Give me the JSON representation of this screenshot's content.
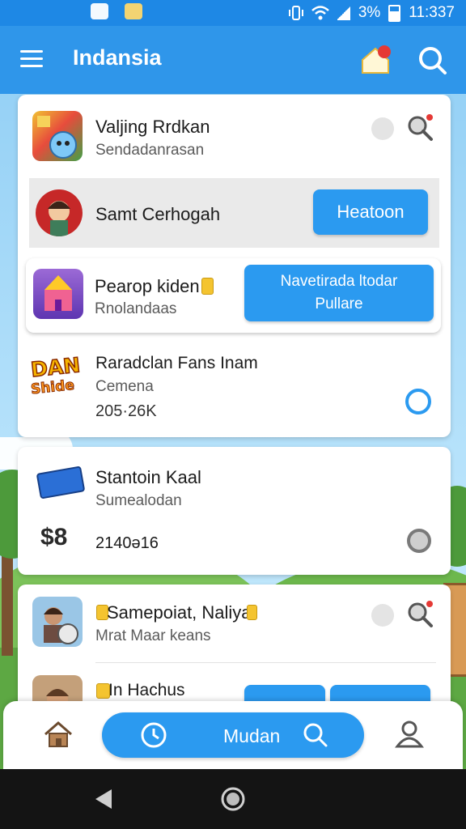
{
  "status_bar": {
    "battery": "3%",
    "time": "11:337"
  },
  "app_bar": {
    "title": "Indansia"
  },
  "cards": {
    "c1": {
      "title": "Valjing Rrdkan",
      "subtitle": "Sendadanrasan"
    },
    "c1_row2": {
      "title": "Samt Cerhogah",
      "button": "Heatoon"
    },
    "c2": {
      "title": "Pearop kiden",
      "subtitle": "Rnolandaas",
      "button_line1": "Navetirada ltodar",
      "button_line2": "Pullare"
    },
    "c3": {
      "logo_top": "DAN",
      "logo_bottom": "Shide",
      "title": "Raradclan Fans Inam",
      "subtitle": "Cemena",
      "value": "205·26K"
    },
    "c4": {
      "title": "Stantoin Kaal",
      "subtitle": "Sumealodan",
      "currency": "$8",
      "value": "2140ə16"
    },
    "c5": {
      "title": "Samepoiat, Naliya",
      "subtitle": "Mrat Maar keans"
    },
    "c6": {
      "title": "In Hachus"
    }
  },
  "bottom_nav": {
    "center_label": "Mudan"
  },
  "colors": {
    "primary": "#2b9af0",
    "appbar": "#2f96ea",
    "statusbar": "#1e88e5"
  },
  "icons": [
    "menu-icon",
    "home-notification-icon",
    "search-icon",
    "home-icon",
    "clock-icon",
    "user-icon",
    "back-icon",
    "home-button-icon"
  ]
}
